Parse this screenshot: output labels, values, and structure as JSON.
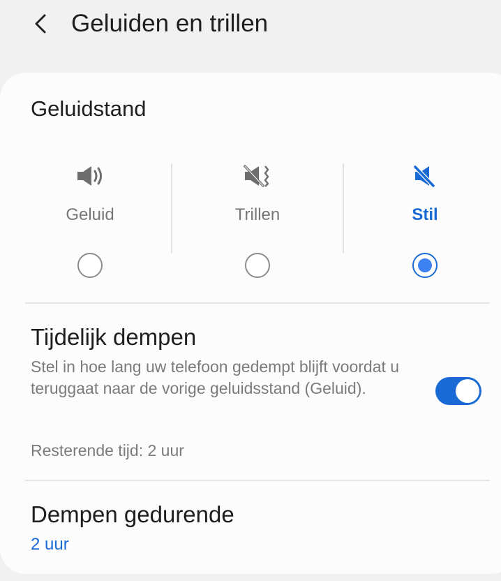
{
  "header": {
    "title": "Geluiden en trillen",
    "back_icon": "chevron-left-icon"
  },
  "sound_mode": {
    "title": "Geluidstand",
    "options": [
      {
        "label": "Geluid",
        "icon": "volume-icon",
        "selected": false
      },
      {
        "label": "Trillen",
        "icon": "vibrate-icon",
        "selected": false
      },
      {
        "label": "Stil",
        "icon": "mute-icon",
        "selected": true
      }
    ]
  },
  "temp_mute": {
    "title": "Tijdelijk dempen",
    "description": "Stel in hoe lang uw telefoon gedempt blijft voordat u teruggaat naar de vorige geluidsstand (Geluid).",
    "toggle_on": true,
    "remaining": "Resterende tijd: 2 uur"
  },
  "mute_duration": {
    "title": "Dempen gedurende",
    "value": "2 uur"
  },
  "colors": {
    "accent": "#1a6ad6",
    "radio_fill": "#3d82f0",
    "icon_gray": "#6e6e6e"
  }
}
